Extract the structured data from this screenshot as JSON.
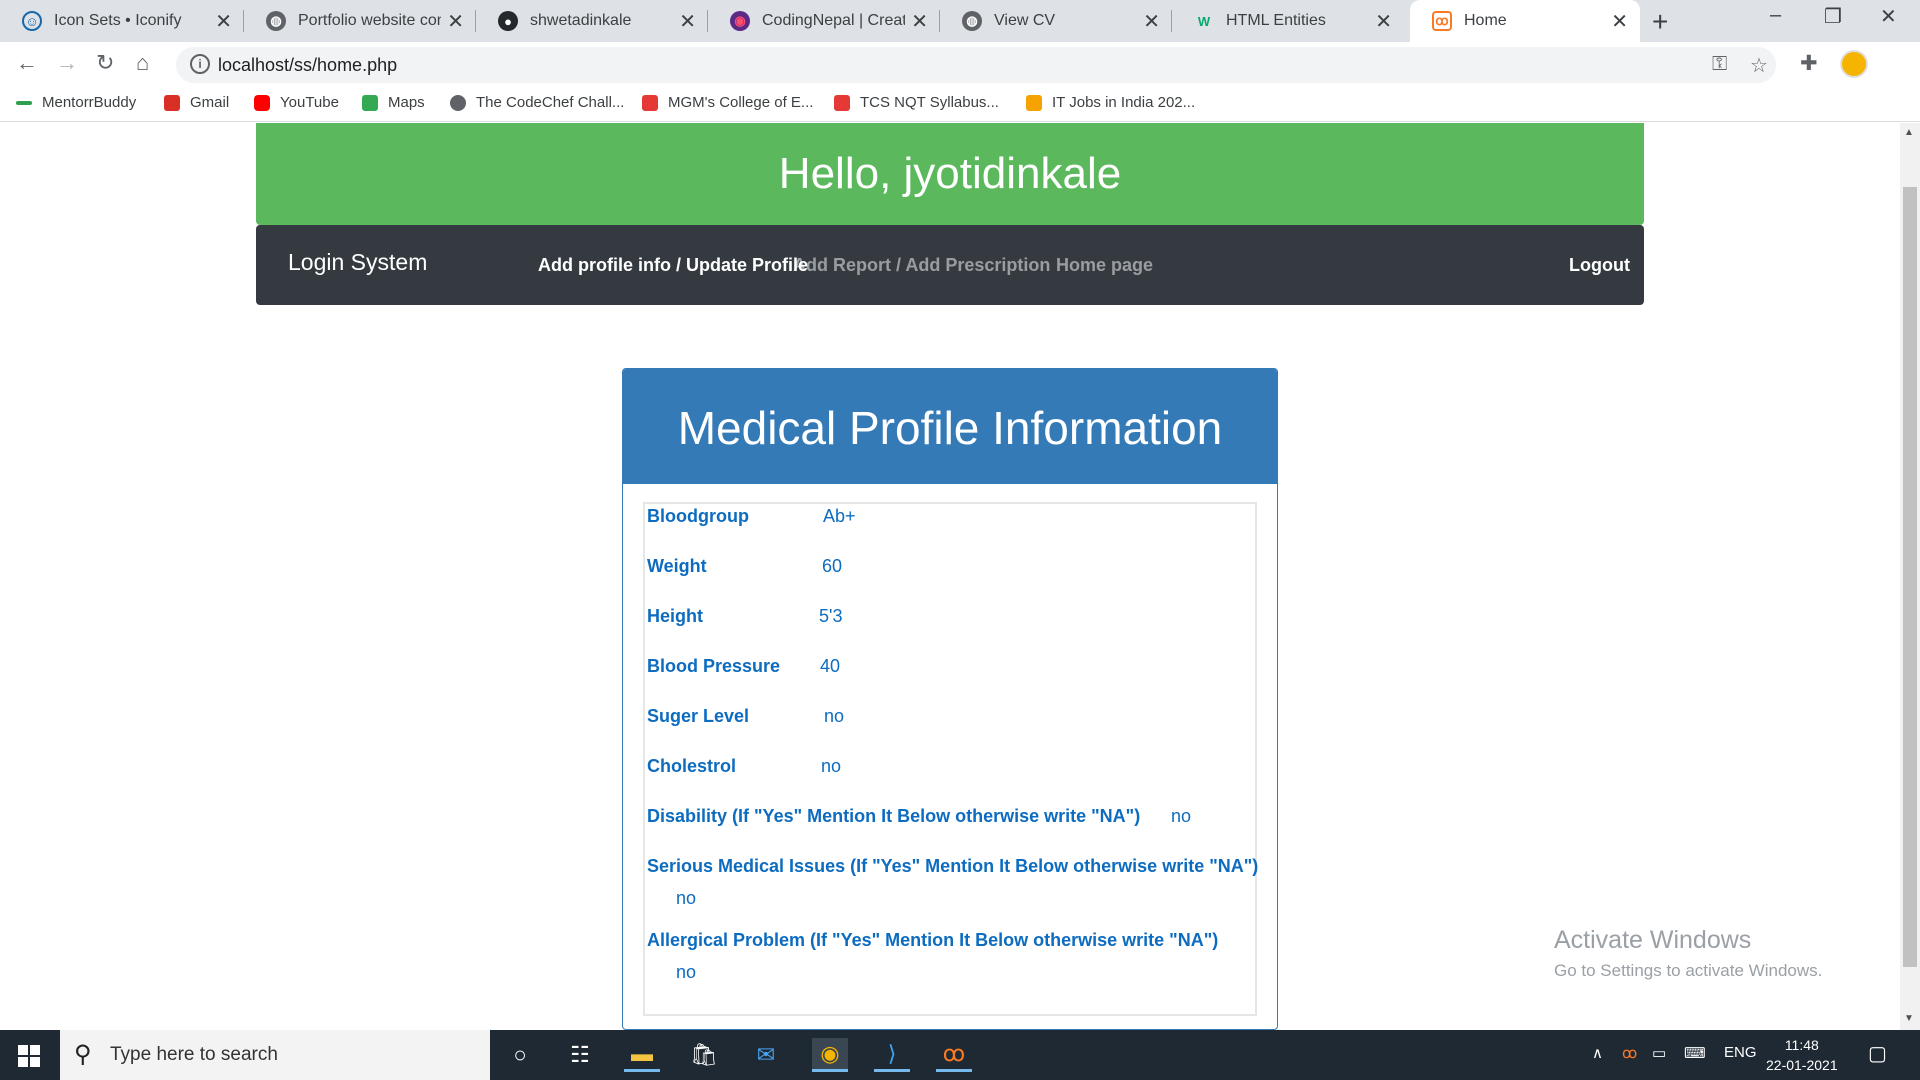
{
  "browser": {
    "tabs": [
      {
        "title": "Icon Sets • Iconify",
        "icon": "smiley-icon",
        "color": "#1769aa"
      },
      {
        "title": "Portfolio website comp",
        "icon": "globe-icon",
        "color": "#5f6368"
      },
      {
        "title": "shwetadinkale",
        "icon": "github-icon",
        "color": "#24292e"
      },
      {
        "title": "CodingNepal | Creative",
        "icon": "codingnepal-icon",
        "color": "#5b2a86"
      },
      {
        "title": "View CV",
        "icon": "globe-icon",
        "color": "#5f6368"
      },
      {
        "title": "HTML Entities",
        "icon": "w3schools-icon",
        "color": "#04aa6d"
      },
      {
        "title": "Home",
        "icon": "xampp-icon",
        "color": "#fb7a24"
      }
    ],
    "url": "localhost/ss/home.php",
    "bookmarks": [
      {
        "label": "MentorrBuddy",
        "color": "#2e9e4f"
      },
      {
        "label": "Gmail",
        "color": "#d93025"
      },
      {
        "label": "YouTube",
        "color": "#ff0000"
      },
      {
        "label": "Maps",
        "color": "#34a853"
      },
      {
        "label": "The CodeChef Chall...",
        "color": "#5f6368"
      },
      {
        "label": "MGM's College of E...",
        "color": "#e53935"
      },
      {
        "label": "TCS NQT Syllabus...",
        "color": "#e53935"
      },
      {
        "label": "IT Jobs in India 202...",
        "color": "#f4a300"
      }
    ]
  },
  "header": {
    "greeting": "Hello, jyotidinkale"
  },
  "nav": {
    "brand": "Login System",
    "links": [
      "Add profile info / Update Profile",
      "Add Report / Add Prescription",
      "Home page"
    ],
    "logout": "Logout"
  },
  "profile": {
    "title": "Medical Profile Information",
    "rows": [
      {
        "label": "Bloodgroup",
        "value": "Ab+"
      },
      {
        "label": "Weight",
        "value": "60"
      },
      {
        "label": "Height",
        "value": "5'3"
      },
      {
        "label": "Blood Pressure",
        "value": "40"
      },
      {
        "label": "Suger Level",
        "value": "no"
      },
      {
        "label": "Cholestrol",
        "value": "no"
      },
      {
        "label": "Disability (If \"Yes\" Mention It Below otherwise write \"NA\")",
        "value": "no"
      },
      {
        "label": "Serious Medical Issues (If \"Yes\" Mention It Below otherwise write \"NA\")",
        "value": "no"
      },
      {
        "label": "Allergical Problem (If \"Yes\" Mention It Below otherwise write \"NA\")",
        "value": "no"
      }
    ]
  },
  "watermark": {
    "line1": "Activate Windows",
    "line2": "Go to Settings to activate Windows."
  },
  "taskbar": {
    "search_placeholder": "Type here to search",
    "language": "ENG",
    "time": "11:48",
    "date": "22-01-2021"
  },
  "colors": {
    "greeting_bg": "#5cb85c",
    "navbar_bg": "#343a40",
    "card_head_bg": "#337ab7",
    "field_text": "#0d6cbf"
  }
}
